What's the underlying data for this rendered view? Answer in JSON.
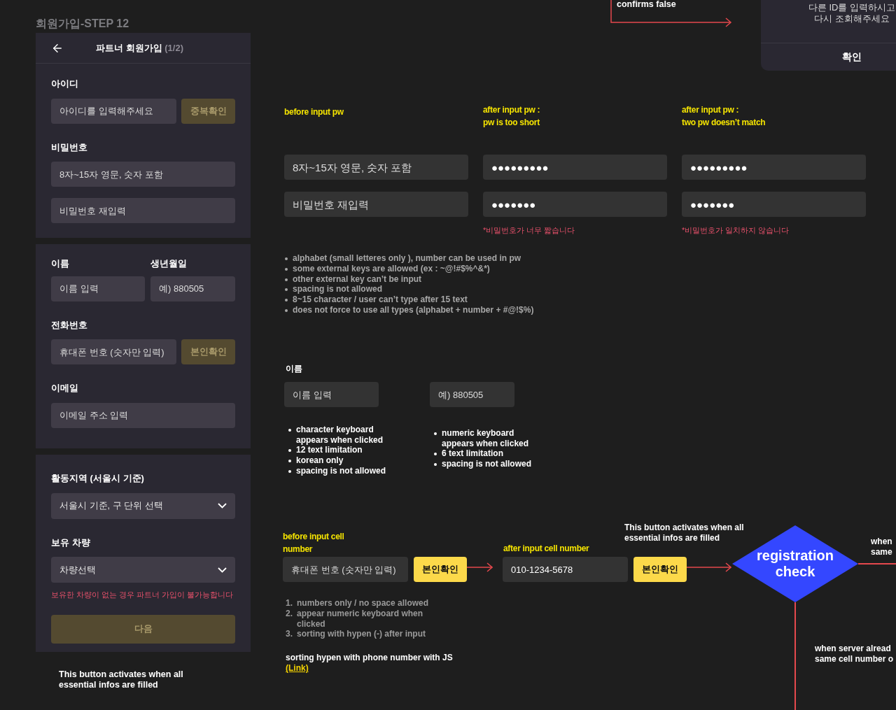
{
  "frame_title": "회원가입-STEP 12",
  "phone": {
    "title": "파트너 회원가입",
    "step": "(1/2)",
    "sections": [
      {
        "items": [
          {
            "kind": "label",
            "text": "아이디"
          },
          {
            "kind": "field",
            "placeholder": "아이디를 입력해주세요",
            "button": {
              "label": "중복확인",
              "disabled": true
            }
          },
          {
            "kind": "label",
            "text": "비밀번호"
          },
          {
            "kind": "field",
            "placeholder": "8자~15자 영문, 숫자 포함"
          },
          {
            "kind": "field",
            "placeholder": "비밀번호 재입력"
          }
        ]
      },
      {
        "items": [
          {
            "kind": "pair",
            "fields": [
              {
                "label": "이름",
                "placeholder": "이름 입력"
              },
              {
                "label": "생년월일",
                "placeholder": "예) 880505"
              }
            ]
          },
          {
            "kind": "label",
            "text": "전화번호"
          },
          {
            "kind": "field",
            "placeholder": "휴대폰 번호 (숫자만 입력)",
            "button": {
              "label": "본인확인",
              "disabled": true
            }
          },
          {
            "kind": "label",
            "text": "이메일"
          },
          {
            "kind": "field",
            "placeholder": "이메일 주소 입력"
          }
        ]
      },
      {
        "items": [
          {
            "kind": "label",
            "text": "활동지역 (서울시 기준)"
          },
          {
            "kind": "select",
            "value": "서울시 기준, 구 단위 선택"
          },
          {
            "kind": "label",
            "text": "보유 차량"
          },
          {
            "kind": "select",
            "value": "차량선택"
          },
          {
            "kind": "warning",
            "text": "보유한 차량이 없는 경우 파트너 가입이 불가능합니다"
          },
          {
            "kind": "submit",
            "label": "다음",
            "disabled": true
          }
        ]
      }
    ]
  },
  "phone_note": "This button activates when all essential infos are filled",
  "top_note": "confirms false",
  "dialog": {
    "message": [
      "다른 ID를 입력하시고",
      "다시 조회해주세요"
    ],
    "button": "확인"
  },
  "password_states": [
    {
      "caption": [
        "before input pw"
      ],
      "fields": [
        {
          "placeholder": "8자~15자 영문, 숫자 포함"
        },
        {
          "placeholder": "비밀번호 재입력"
        }
      ]
    },
    {
      "caption": [
        "after input pw :",
        "pw is too short"
      ],
      "fields": [
        {
          "value": "●●●●●●●●●"
        },
        {
          "value": "●●●●●●●"
        }
      ],
      "error": "*비밀번호가 너무 짧습니다"
    },
    {
      "caption": [
        "after input pw :",
        "two pw doesn’t match"
      ],
      "fields": [
        {
          "value": "●●●●●●●●●"
        },
        {
          "value": "●●●●●●●"
        }
      ],
      "error": "*비밀번호가 일치하지 않습니다"
    }
  ],
  "password_rules": [
    "alphabet (small letteres only ), number can be used in pw",
    "some external keys are allowed (ex : ~@!#$%^&*)",
    "other external key can’t be input",
    "spacing is not allowed",
    "8~15 character / user can’t type after 15 text",
    "does not force to use all types (alphabet + number + #@!$%)"
  ],
  "name_spec": {
    "label": "이름",
    "columns": [
      {
        "placeholder": "이름 입력",
        "rules": [
          "character keyboard appears when clicked",
          "12 text limitation",
          "korean only",
          "spacing is not allowed"
        ]
      },
      {
        "placeholder": "예) 880505",
        "rules": [
          "numeric keyboard appears when clicked",
          "6 text limitation",
          "spacing is not allowed"
        ]
      }
    ]
  },
  "cell_spec": {
    "states": [
      {
        "caption": "before input cell number",
        "placeholder": "휴대폰 번호 (숫자만 입력)",
        "button": "본인확인"
      },
      {
        "caption": "after input cell number",
        "value": "010-1234-5678",
        "button": "본인확인"
      }
    ],
    "button_note": "This button activates when all essential infos are filled",
    "steps": [
      {
        "number": "1.",
        "text": "numbers only / no space allowed"
      },
      {
        "number": "2.",
        "text": "appear numeric keyboard when clicked"
      },
      {
        "number": "3.",
        "text": "sorting with hypen (-) after input"
      }
    ],
    "js_note": "sorting hypen with phone number with JS",
    "link": "(Link)",
    "decision": "registration check",
    "branch_right": [
      "when",
      "same"
    ],
    "branch_down": [
      "when server alread",
      "same cell number o"
    ]
  }
}
